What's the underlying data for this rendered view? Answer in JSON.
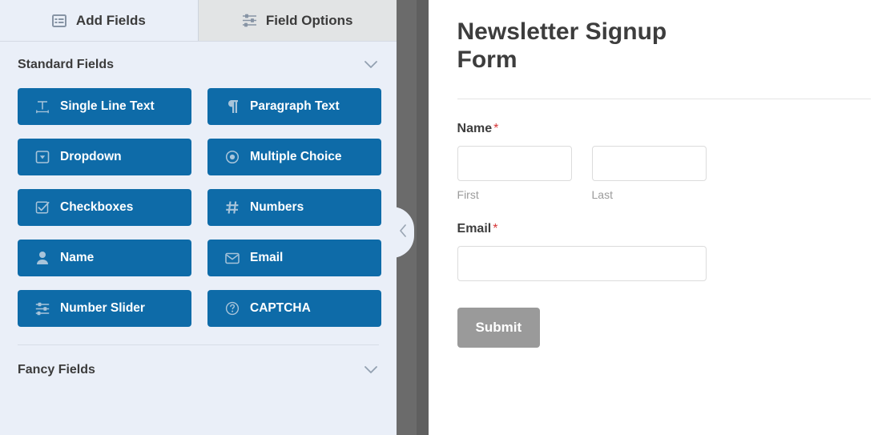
{
  "builder": {
    "tabs": [
      {
        "label": "Add Fields",
        "icon": "list-icon",
        "active": true
      },
      {
        "label": "Field Options",
        "icon": "sliders-icon",
        "active": false
      }
    ],
    "sections": [
      {
        "title": "Standard Fields",
        "chevron": "chevron-down-icon",
        "expanded": true
      },
      {
        "title": "Fancy Fields",
        "chevron": "chevron-down-icon",
        "expanded": false
      }
    ],
    "standard_fields": [
      {
        "label": "Single Line Text",
        "icon": "text-width-icon"
      },
      {
        "label": "Paragraph Text",
        "icon": "paragraph-icon"
      },
      {
        "label": "Dropdown",
        "icon": "dropdown-caret-icon"
      },
      {
        "label": "Multiple Choice",
        "icon": "radio-button-icon"
      },
      {
        "label": "Checkboxes",
        "icon": "checkbox-checked-icon"
      },
      {
        "label": "Numbers",
        "icon": "hash-icon"
      },
      {
        "label": "Name",
        "icon": "user-icon"
      },
      {
        "label": "Email",
        "icon": "envelope-icon"
      },
      {
        "label": "Number Slider",
        "icon": "sliders-icon"
      },
      {
        "label": "CAPTCHA",
        "icon": "question-circle-icon"
      }
    ],
    "collapse_handle": {
      "icon": "chevron-left-icon"
    },
    "colors": {
      "field_button": "#0e6ba8",
      "panel_background": "#eaeff8",
      "active_tab": "#eaeff8",
      "inactive_tab": "#e2e4e5",
      "divider": "#6b6b6b",
      "required_marker": "#d63638",
      "submit_button": "#9a9a9a"
    }
  },
  "preview": {
    "form_title": "Newsletter Signup Form",
    "fields": [
      {
        "label": "Name",
        "required_marker": "*",
        "sub_fields": [
          {
            "sub_label": "First",
            "value": "",
            "placeholder": ""
          },
          {
            "sub_label": "Last",
            "value": "",
            "placeholder": ""
          }
        ]
      },
      {
        "label": "Email",
        "required_marker": "*",
        "value": "",
        "placeholder": ""
      }
    ],
    "submit_label": "Submit"
  }
}
